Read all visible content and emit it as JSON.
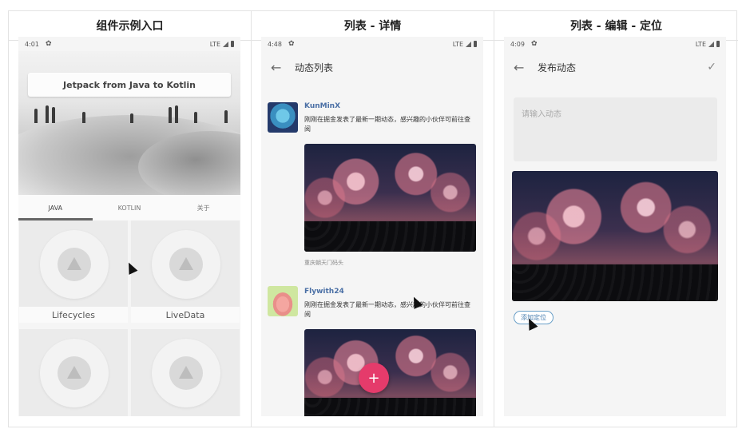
{
  "columns": [
    {
      "header": "组件示例入口"
    },
    {
      "header": "列表 - 详情"
    },
    {
      "header": "列表 - 编辑 - 定位"
    }
  ],
  "phone1": {
    "status_time": "4:01",
    "status_network": "LTE",
    "banner_title": "Jetpack from Java to Kotlin",
    "tabs": [
      "JAVA",
      "KOTLIN",
      "关于"
    ],
    "active_tab": "JAVA",
    "cards": [
      {
        "label": "Lifecycles"
      },
      {
        "label": "LiveData"
      },
      {
        "label": ""
      },
      {
        "label": ""
      }
    ]
  },
  "phone2": {
    "status_time": "4:48",
    "status_network": "LTE",
    "title": "动态列表",
    "back_icon": "arrow-left-icon",
    "posts": [
      {
        "user": "KunMinX",
        "text": "刚刚在掘金发表了最新一期动态，感兴趣的小伙伴可前往查阅",
        "location": "重庆朝天门码头"
      },
      {
        "user": "Flywith24",
        "text": "刚刚在掘金发表了最新一期动态，感兴趣的小伙伴可前往查阅",
        "location": ""
      }
    ],
    "fab_label": "+",
    "fab_color": "#e53b6b"
  },
  "phone3": {
    "status_time": "4:09",
    "status_network": "LTE",
    "title": "发布动态",
    "confirm_icon": "check-icon",
    "input_placeholder": "请输入动态",
    "location_chip": "添加定位"
  }
}
